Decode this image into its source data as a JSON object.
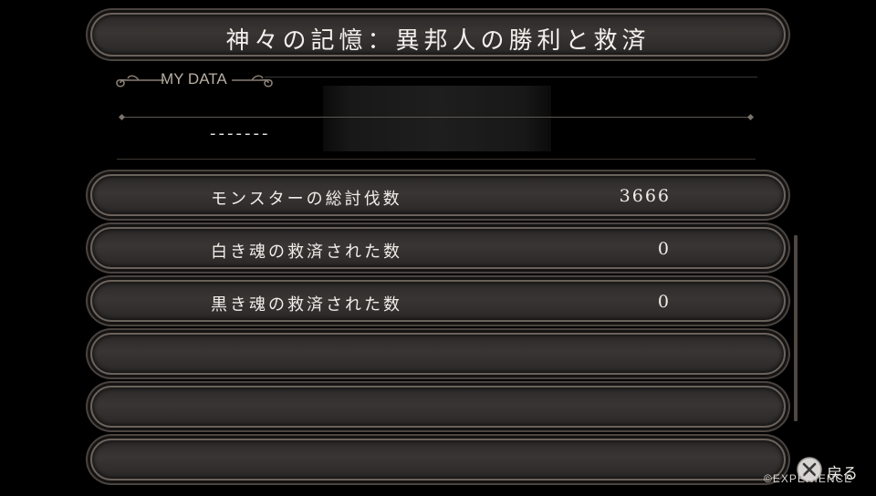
{
  "screen_title": "神々の記憶：異邦人の勝利と救済",
  "my_data": {
    "section_label": "MY DATA",
    "player_name": "-------"
  },
  "stats": [
    {
      "label": "モンスターの総討伐数",
      "value": "3666"
    },
    {
      "label": "白き魂の救済された数",
      "value": "0"
    },
    {
      "label": "黒き魂の救済された数",
      "value": "0"
    },
    {
      "label": "",
      "value": ""
    },
    {
      "label": "",
      "value": ""
    },
    {
      "label": "",
      "value": ""
    }
  ],
  "footer": {
    "back_button_icon": "cross-button-icon",
    "back_label": "戻る",
    "copyright": "©EXPERIENCE"
  }
}
